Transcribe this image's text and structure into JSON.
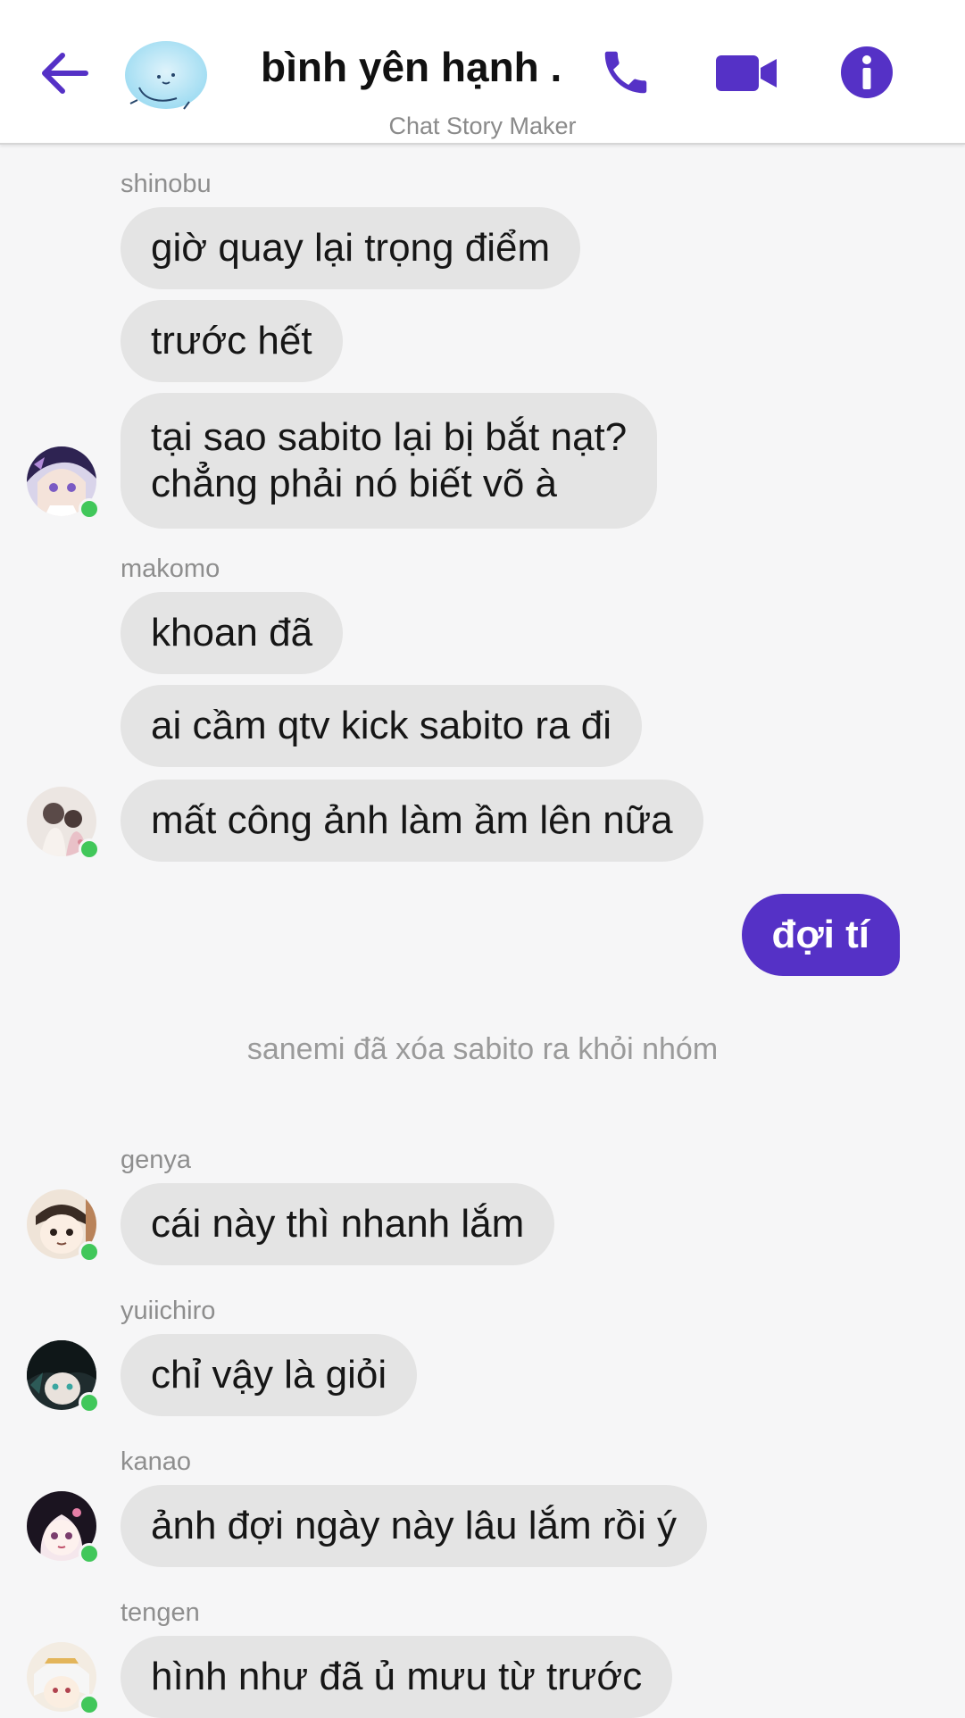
{
  "header": {
    "title": "bình yên hạnh ...",
    "subtitle": "Chat Story Maker",
    "accent_color": "#5531c6",
    "icons": [
      "back-arrow-icon",
      "phone-icon",
      "video-camera-icon",
      "info-icon"
    ]
  },
  "messages": {
    "shinobu": {
      "name": "shinobu",
      "m1": "giờ quay lại trọng điểm",
      "m2": "trước hết",
      "m3_line1": "tại sao sabito lại bị bắt nạt?",
      "m3_line2": "chẳng phải nó biết võ à"
    },
    "makomo": {
      "name": "makomo",
      "m1": "khoan đã",
      "m2": "ai cầm qtv kick sabito ra đi",
      "m3": "mất công ảnh làm ầm lên nữa"
    },
    "me": {
      "m1": "đợi tí"
    },
    "system": {
      "text": "sanemi đã xóa sabito ra khỏi nhóm"
    },
    "genya": {
      "name": "genya",
      "m1": "cái này thì nhanh lắm"
    },
    "yuiichiro": {
      "name": "yuiichiro",
      "m1": "chỉ vậy là giỏi"
    },
    "kanao": {
      "name": "kanao",
      "m1": "ảnh đợi ngày này lâu lắm rồi ý"
    },
    "tengen": {
      "name": "tengen",
      "m1": "hình như đã ủ mưu từ trước"
    }
  }
}
